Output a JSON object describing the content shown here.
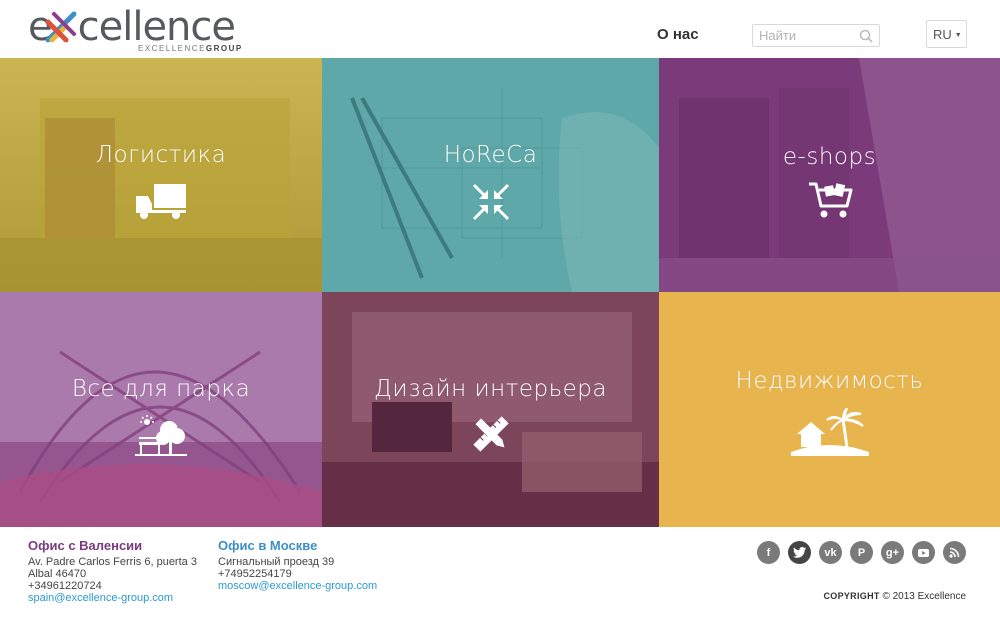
{
  "header": {
    "logo_text_pre": "e",
    "logo_text_post": "cellence",
    "logo_sub_light": "EXCELLENCE",
    "logo_sub_bold": "GROUP",
    "nav_about": "О нас",
    "search_placeholder": "Найти",
    "lang": "RU"
  },
  "tiles": [
    {
      "label": "Логистика",
      "icon": "truck-icon",
      "overlay": "#c9b23e"
    },
    {
      "label": "HoReCa",
      "icon": "compress-arrows-icon",
      "overlay": "#3f9d9c"
    },
    {
      "label": "e-shops",
      "icon": "shopping-cart-icon",
      "overlay": "#8a3e8e"
    },
    {
      "label": "Все для парка",
      "icon": "park-bench-tree-icon",
      "overlay": "#9b4f9d"
    },
    {
      "label": "Дизайн интерьера",
      "icon": "ruler-pencil-icon",
      "overlay": "#6e2f52"
    },
    {
      "label": "Недвижимость",
      "icon": "island-house-icon",
      "overlay": "#e8b44e"
    }
  ],
  "footer": {
    "valencia": {
      "title": "Офис с Валенсии",
      "address1": "Av. Padre Carlos Ferris 6, puerta 3",
      "address2": "Albal 46470",
      "phone": "+34961220724",
      "email": "spain@excellence-group.com"
    },
    "moscow": {
      "title": "Офис в Москве",
      "address1": "Сигнальный проезд 39",
      "phone": "+74952254179",
      "email": "moscow@excellence-group.com"
    },
    "social": [
      "facebook-icon",
      "twitter-icon",
      "vk-icon",
      "pinterest-icon",
      "google-plus-icon",
      "youtube-icon",
      "rss-icon"
    ],
    "copyright_label": "COPYRIGHT",
    "copyright_text": "© 2013 Excellence"
  }
}
